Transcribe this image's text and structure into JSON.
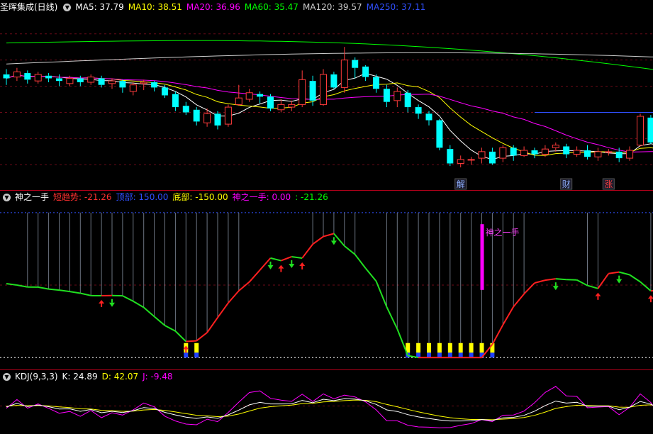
{
  "main": {
    "title": "圣晖集成(日线)",
    "ma": [
      {
        "label": "MA5: 37.79",
        "color": "#ffffff"
      },
      {
        "label": "MA10: 38.51",
        "color": "#ffff00"
      },
      {
        "label": "MA20: 36.96",
        "color": "#ff00ff"
      },
      {
        "label": "MA60: 35.47",
        "color": "#00ff00"
      },
      {
        "label": "MA120: 39.57",
        "color": "#cccccc"
      },
      {
        "label": "MA250: 37.11",
        "color": "#3050ff"
      }
    ],
    "price_high": "42",
    "price_low": "31.00",
    "badges": [
      {
        "text": "解",
        "idx": 43
      },
      {
        "text": "财",
        "idx": 53
      },
      {
        "text": "涨",
        "idx": 57
      }
    ]
  },
  "indicator": {
    "title": "神之一手",
    "items": [
      {
        "label": "短趋势: -21.26",
        "color": "#ff3030"
      },
      {
        "label": "顶部: 150.00",
        "color": "#3050ff"
      },
      {
        "label": "底部: -150.00",
        "color": "#ffff00"
      },
      {
        "label": "神之一手: 0.00",
        "color": "#ff00ff"
      },
      {
        "label": ": -21.26",
        "color": "#00ff00"
      }
    ],
    "signal_label": "神之一手"
  },
  "kdj": {
    "title": "KDJ(9,3,3)",
    "items": [
      {
        "label": "K: 24.89",
        "color": "#ffffff"
      },
      {
        "label": "D: 42.07",
        "color": "#ffff00"
      },
      {
        "label": "J: -9.48",
        "color": "#ff00ff"
      }
    ]
  },
  "colors": {
    "up": "#ff3b3b",
    "down": "#00ffff",
    "separator": "#b0001a"
  },
  "chart_data": {
    "type": "candlestick",
    "candles": [
      [
        38.9,
        38.6,
        39.3,
        38.1
      ],
      [
        38.7,
        39.1,
        39.4,
        38.4
      ],
      [
        39.0,
        38.5,
        39.2,
        38.2
      ],
      [
        38.4,
        38.9,
        39.1,
        38.2
      ],
      [
        38.8,
        38.6,
        39.0,
        38.3
      ],
      [
        38.6,
        38.4,
        38.9,
        38.0
      ],
      [
        38.2,
        38.6,
        38.8,
        38.0
      ],
      [
        38.6,
        38.3,
        38.8,
        38.0
      ],
      [
        38.3,
        38.7,
        38.9,
        38.1
      ],
      [
        38.6,
        38.1,
        38.8,
        37.9
      ],
      [
        38.2,
        38.4,
        38.6,
        37.8
      ],
      [
        38.4,
        37.9,
        38.5,
        37.5
      ],
      [
        37.6,
        38.1,
        38.3,
        37.3
      ],
      [
        38.2,
        38.3,
        38.5,
        37.7
      ],
      [
        38.3,
        37.9,
        38.4,
        37.6
      ],
      [
        37.9,
        37.3,
        38.1,
        37.1
      ],
      [
        37.4,
        36.4,
        37.6,
        36.1
      ],
      [
        36.5,
        36.0,
        36.8,
        35.8
      ],
      [
        36.2,
        35.3,
        36.4,
        35.0
      ],
      [
        35.2,
        35.9,
        36.3,
        34.9
      ],
      [
        35.9,
        35.0,
        36.1,
        34.7
      ],
      [
        35.1,
        36.4,
        36.6,
        34.9
      ],
      [
        36.6,
        37.1,
        38.1,
        36.5
      ],
      [
        37.0,
        37.5,
        37.8,
        36.8
      ],
      [
        37.4,
        37.2,
        37.6,
        36.7
      ],
      [
        37.2,
        36.3,
        37.4,
        36.1
      ],
      [
        36.2,
        36.6,
        37.0,
        36.0
      ],
      [
        36.4,
        36.6,
        36.9,
        36.1
      ],
      [
        36.6,
        38.5,
        39.2,
        36.4
      ],
      [
        38.4,
        36.9,
        38.8,
        36.5
      ],
      [
        36.6,
        38.9,
        39.3,
        36.5
      ],
      [
        38.9,
        37.9,
        39.1,
        37.8
      ],
      [
        37.9,
        40.0,
        41.0,
        37.5
      ],
      [
        40.0,
        39.4,
        40.2,
        38.6
      ],
      [
        39.5,
        38.7,
        39.6,
        38.4
      ],
      [
        38.7,
        37.8,
        38.9,
        37.5
      ],
      [
        37.8,
        36.8,
        38.1,
        36.4
      ],
      [
        36.9,
        37.6,
        37.9,
        36.4
      ],
      [
        37.5,
        36.4,
        37.7,
        36.0
      ],
      [
        36.4,
        35.9,
        36.6,
        35.5
      ],
      [
        35.9,
        35.4,
        36.1,
        35.0
      ],
      [
        35.4,
        33.3,
        35.5,
        33.1
      ],
      [
        33.2,
        32.1,
        33.5,
        31.9
      ],
      [
        32.1,
        32.4,
        32.7,
        31.8
      ],
      [
        32.4,
        32.4,
        32.6,
        32.0
      ],
      [
        32.5,
        33.0,
        33.3,
        32.1
      ],
      [
        33.0,
        32.1,
        33.3,
        32.0
      ],
      [
        32.5,
        33.3,
        33.5,
        32.2
      ],
      [
        33.3,
        32.7,
        33.5,
        32.3
      ],
      [
        32.7,
        33.1,
        33.4,
        32.6
      ],
      [
        33.1,
        32.8,
        33.3,
        32.5
      ],
      [
        32.8,
        33.2,
        33.5,
        32.6
      ],
      [
        33.3,
        33.5,
        33.7,
        33.0
      ],
      [
        33.4,
        32.8,
        33.6,
        32.5
      ],
      [
        32.8,
        33.1,
        33.4,
        32.6
      ],
      [
        33.1,
        32.6,
        33.5,
        32.4
      ],
      [
        32.6,
        33.0,
        33.3,
        32.3
      ],
      [
        33.0,
        33.0,
        33.2,
        32.7
      ],
      [
        33.0,
        32.5,
        33.3,
        32.2
      ],
      [
        32.5,
        33.1,
        33.4,
        32.3
      ],
      [
        33.5,
        35.7,
        35.9,
        33.4
      ],
      [
        35.6,
        33.7,
        35.8,
        33.6
      ],
      [
        33.7,
        32.4,
        33.9,
        32.2
      ],
      [
        32.4,
        31.9,
        32.8,
        31.6
      ],
      [
        32.0,
        31.4,
        32.3,
        31.0
      ],
      [
        31.4,
        32.6,
        32.9,
        31.3
      ],
      [
        32.6,
        32.9,
        33.2,
        32.4
      ],
      [
        32.9,
        33.8,
        34.4,
        32.8
      ],
      [
        33.8,
        33.3,
        34.0,
        33.0
      ],
      [
        33.3,
        32.6,
        33.5,
        32.2
      ],
      [
        32.6,
        34.5,
        34.8,
        32.5
      ],
      [
        34.5,
        34.9,
        35.2,
        34.3
      ],
      [
        34.9,
        34.6,
        35.1,
        34.3
      ],
      [
        34.6,
        34.9,
        35.2,
        34.4
      ],
      [
        34.9,
        35.2,
        35.5,
        34.7
      ],
      [
        35.1,
        35.6,
        35.9,
        34.9
      ],
      [
        35.6,
        36.3,
        38.0,
        35.4
      ],
      [
        36.3,
        35.9,
        36.7,
        35.5
      ],
      [
        35.9,
        36.6,
        36.9,
        35.7
      ],
      [
        36.6,
        37.0,
        37.6,
        36.4
      ],
      [
        37.1,
        35.7,
        37.6,
        35.4
      ],
      [
        35.7,
        37.8,
        38.5,
        35.6
      ],
      [
        38.1,
        40.1,
        41.9,
        38.0
      ],
      [
        40.1,
        38.7,
        40.5,
        38.4
      ],
      [
        38.3,
        38.7,
        38.9,
        38.1
      ]
    ]
  }
}
